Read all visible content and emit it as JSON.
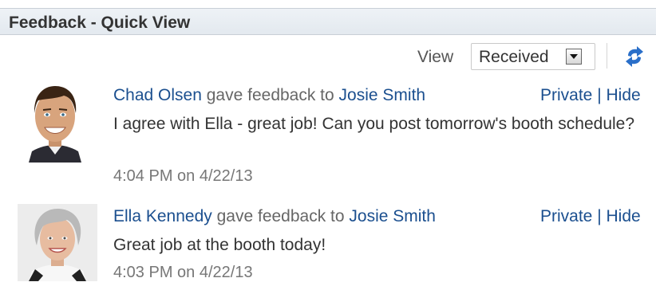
{
  "header": {
    "title": "Feedback - Quick View"
  },
  "toolbar": {
    "view_label": "View",
    "view_selected": "Received",
    "refresh_icon": "refresh-icon"
  },
  "feedback": [
    {
      "giver": "Chad Olsen",
      "action": "gave feedback to",
      "recipient": "Josie Smith",
      "private_label": "Private",
      "separator": "|",
      "hide_label": "Hide",
      "message": "I agree with Ella - great job! Can you post tomorrow's booth schedule?",
      "timestamp": "4:04 PM on 4/22/13"
    },
    {
      "giver": "Ella Kennedy",
      "action": "gave feedback to",
      "recipient": "Josie Smith",
      "private_label": "Private",
      "separator": "|",
      "hide_label": "Hide",
      "message": "Great job at the booth today!",
      "timestamp": "4:03 PM on 4/22/13"
    }
  ],
  "colors": {
    "link": "#1b4f8f",
    "header_bg": "#e9eef3",
    "refresh": "#2a6fc9"
  }
}
